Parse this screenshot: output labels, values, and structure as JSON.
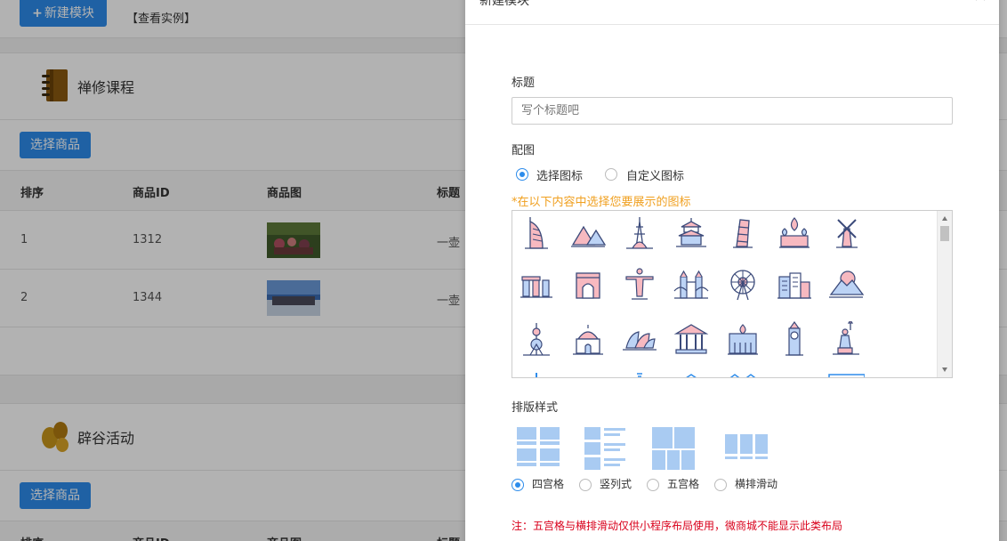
{
  "background": {
    "new_module_label": "新建模块",
    "view_example_label": "【查看实例】",
    "modules": [
      {
        "title": "禅修课程",
        "select_label": "选择商品",
        "columns": [
          "排序",
          "商品ID",
          "商品图",
          "标题"
        ],
        "rows": [
          {
            "order": "1",
            "id": "1312",
            "title": "一壶"
          },
          {
            "order": "2",
            "id": "1344",
            "title": "一壶"
          }
        ]
      },
      {
        "title": "辟谷活动",
        "select_label": "选择商品",
        "columns": [
          "排序",
          "商品ID",
          "商品图",
          "标题"
        ]
      }
    ]
  },
  "modal": {
    "title": "新建模块",
    "title_label": "标题",
    "title_placeholder": "写个标题吧",
    "image_label": "配图",
    "image_options": [
      {
        "label": "选择图标",
        "selected": true
      },
      {
        "label": "自定义图标",
        "selected": false
      }
    ],
    "icon_hint": "*在以下内容中选择您要展示的图标",
    "icons": [
      "burj-al-arab-icon",
      "pyramids-icon",
      "eiffel-tower-icon",
      "temple-of-heaven-icon",
      "leaning-tower-icon",
      "st-basil-cathedral-icon",
      "windmill-icon",
      "stonehenge-icon",
      "arc-de-triomphe-icon",
      "christ-redeemer-icon",
      "tower-bridge-icon",
      "ferris-wheel-icon",
      "city-buildings-icon",
      "mount-fuji-icon",
      "oriental-pearl-tower-icon",
      "mosque-icon",
      "sydney-opera-house-icon",
      "parthenon-icon",
      "palace-icon",
      "big-ben-icon",
      "statue-of-liberty-icon"
    ],
    "layout_label": "排版样式",
    "layout_options": [
      {
        "label": "四宫格",
        "selected": true
      },
      {
        "label": "竖列式",
        "selected": false
      },
      {
        "label": "五宫格",
        "selected": false
      },
      {
        "label": "横排滑动",
        "selected": false
      }
    ],
    "note": "注：五宫格与横排滑动仅供小程序布局使用，微商城不能显示此类布局"
  }
}
